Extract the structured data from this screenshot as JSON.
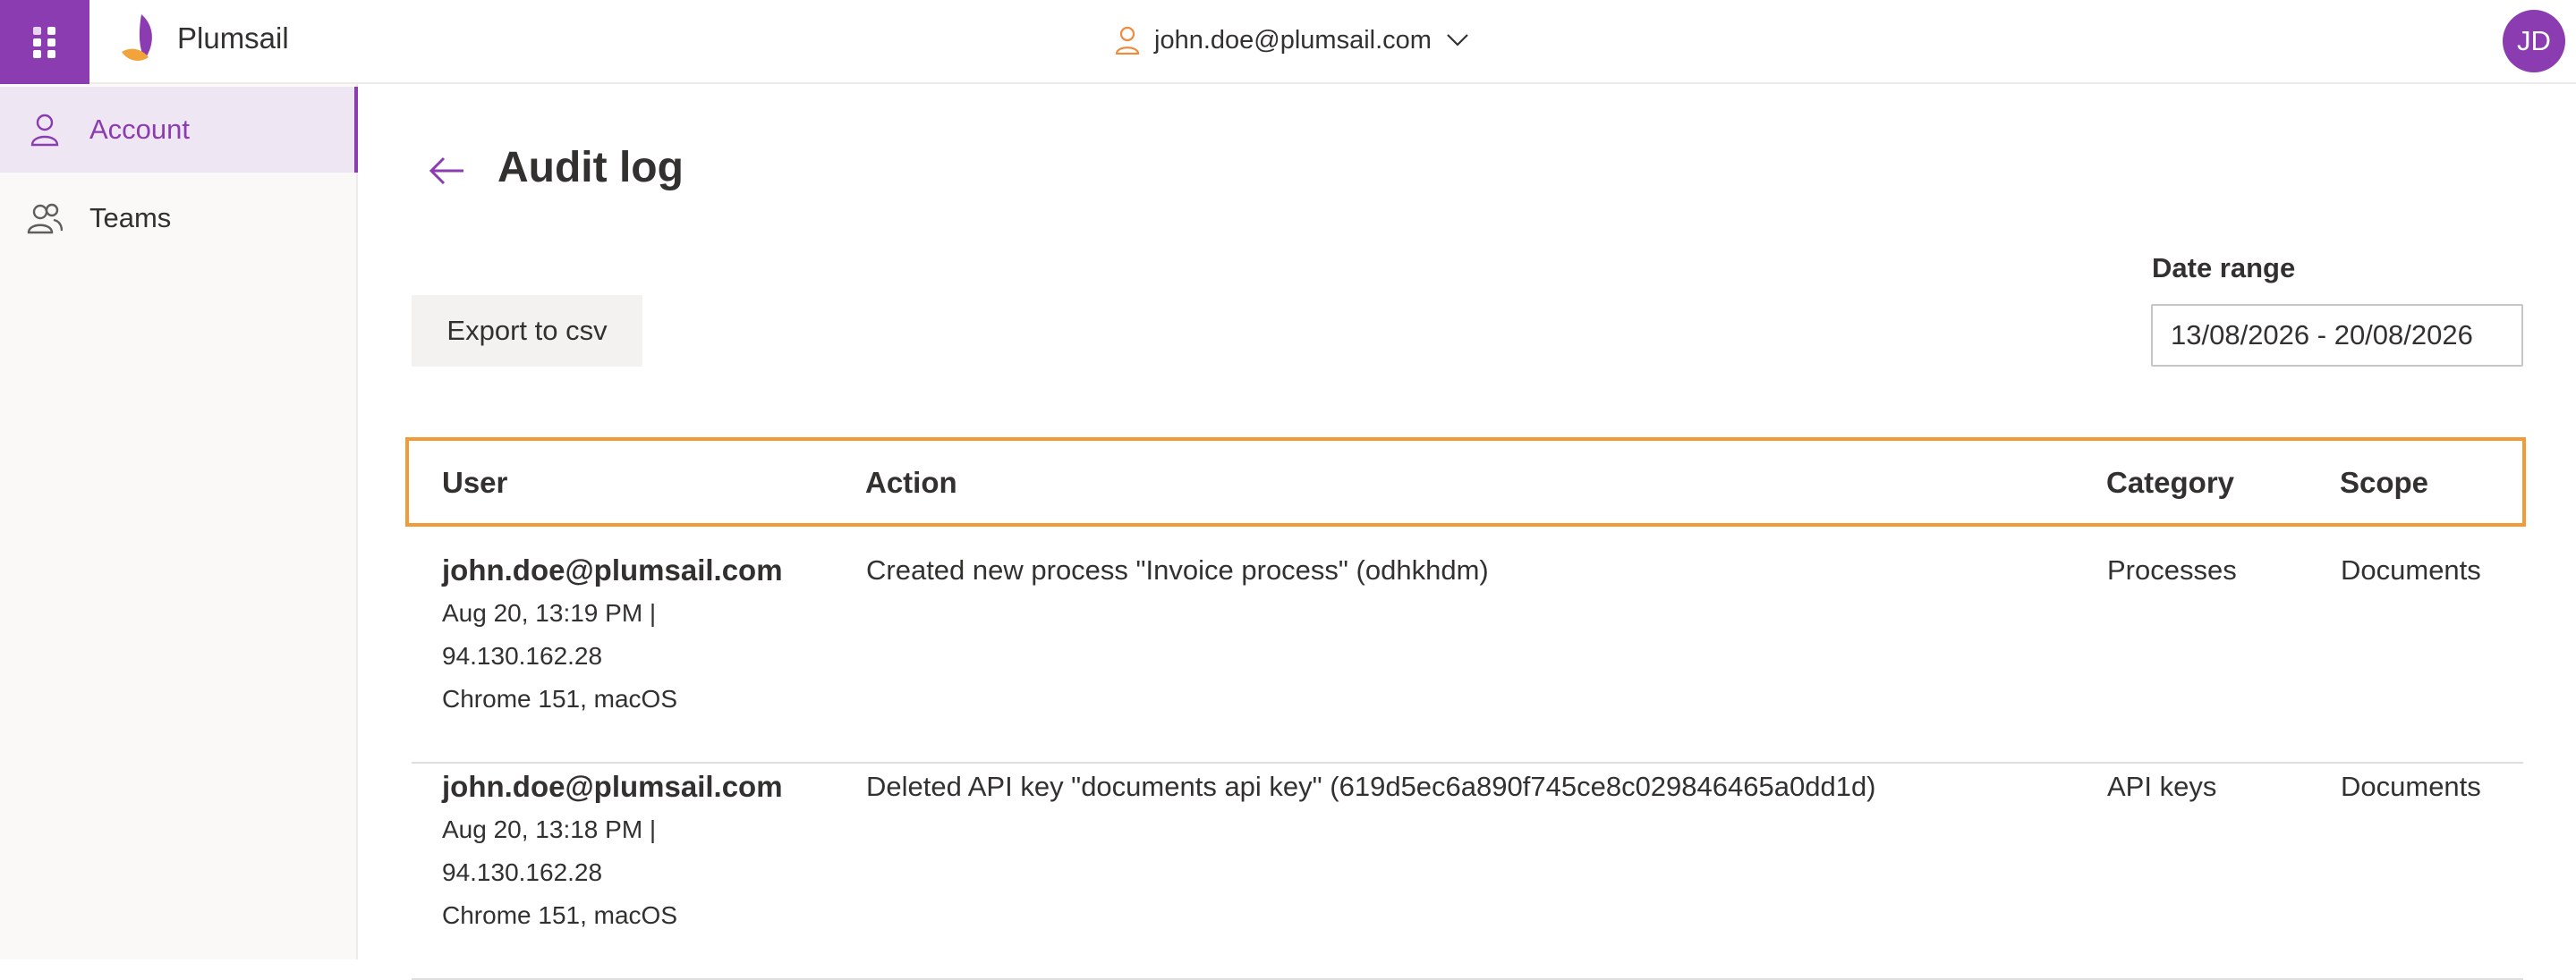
{
  "header": {
    "brand": "Plumsail",
    "account_email": "john.doe@plumsail.com",
    "avatar_initials": "JD"
  },
  "sidebar": {
    "items": [
      {
        "label": "Account",
        "icon": "person-icon",
        "active": true
      },
      {
        "label": "Teams",
        "icon": "people-icon",
        "active": false
      }
    ]
  },
  "main": {
    "title": "Audit log",
    "export_label": "Export to csv",
    "date_range_label": "Date range",
    "date_range_value": "13/08/2026 - 20/08/2026",
    "columns": {
      "user": "User",
      "action": "Action",
      "category": "Category",
      "scope": "Scope"
    },
    "rows": [
      {
        "user": "john.doe@plumsail.com",
        "time": "Aug 20, 13:19 PM |",
        "ip": "94.130.162.28",
        "agent": "Chrome 151, macOS",
        "action": "Created new process \"Invoice process\" (odhkhdm)",
        "category": "Processes",
        "scope": "Documents"
      },
      {
        "user": "john.doe@plumsail.com",
        "time": "Aug 20, 13:18 PM |",
        "ip": "94.130.162.28",
        "agent": "Chrome 151, macOS",
        "action": "Deleted API key \"documents api key\" (619d5ec6a890f745ce8c029846465a0dd1d)",
        "category": "API keys",
        "scope": "Documents"
      }
    ]
  },
  "colors": {
    "brand_purple": "#8a3cb0",
    "highlight_orange": "#f2993a",
    "active_nav_bg": "#efe6f4"
  }
}
